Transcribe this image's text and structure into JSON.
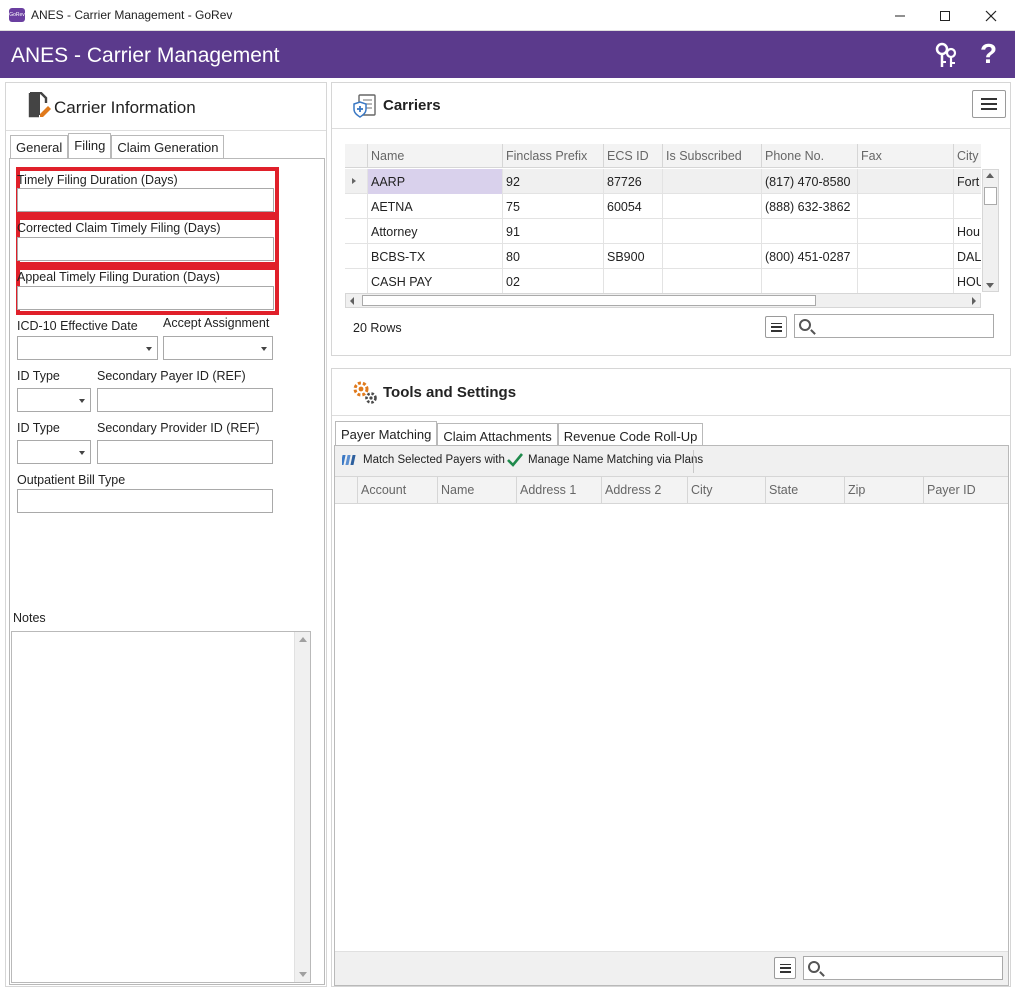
{
  "window": {
    "title": "ANES - Carrier Management - GoRev",
    "app_icon_text": "GoRev",
    "controls": [
      "minimize",
      "maximize",
      "close"
    ]
  },
  "header": {
    "title": "ANES - Carrier Management",
    "help_label": "?",
    "color": "#5b3a8c"
  },
  "carrier_info": {
    "title": "Carrier Information",
    "tabs": [
      "General",
      "Filing",
      "Claim Generation"
    ],
    "active_tab": "Filing",
    "fields": {
      "timely_filing": {
        "label": "Timely Filing Duration (Days)",
        "value": ""
      },
      "corrected_claim": {
        "label": "Corrected Claim Timely Filing (Days)",
        "value": ""
      },
      "appeal_filing": {
        "label": "Appeal Timely Filing Duration (Days)",
        "value": ""
      },
      "icd10_date": {
        "label": "ICD-10 Effective Date",
        "value": ""
      },
      "accept_assignment": {
        "label": "Accept Assignment",
        "value": ""
      },
      "id_type_1": {
        "label": "ID Type",
        "value": ""
      },
      "secondary_payer_id": {
        "label": "Secondary Payer ID (REF)",
        "value": ""
      },
      "id_type_2": {
        "label": "ID Type",
        "value": ""
      },
      "secondary_provider_id": {
        "label": "Secondary Provider ID (REF)",
        "value": ""
      },
      "outpatient_bill_type": {
        "label": "Outpatient Bill Type",
        "value": ""
      }
    },
    "notes_label": "Notes",
    "highlight_color": "#e0202a"
  },
  "carriers": {
    "title": "Carriers",
    "columns": [
      "Name",
      "Finclass Prefix",
      "ECS ID",
      "Is Subscribed",
      "Phone No.",
      "Fax",
      "City"
    ],
    "rows": [
      {
        "name": "AARP",
        "finclass": "92",
        "ecs": "87726",
        "subscribed": "",
        "phone": "(817) 470-8580",
        "fax": "",
        "city": "Fort"
      },
      {
        "name": "AETNA",
        "finclass": "75",
        "ecs": "60054",
        "subscribed": "",
        "phone": "(888) 632-3862",
        "fax": "",
        "city": ""
      },
      {
        "name": "Attorney",
        "finclass": "91",
        "ecs": "",
        "subscribed": "",
        "phone": "",
        "fax": "",
        "city": "Hou"
      },
      {
        "name": "BCBS-TX",
        "finclass": "80",
        "ecs": "SB900",
        "subscribed": "",
        "phone": "(800) 451-0287",
        "fax": "",
        "city": "DAL"
      },
      {
        "name": "CASH PAY",
        "finclass": "02",
        "ecs": "",
        "subscribed": "",
        "phone": "",
        "fax": "",
        "city": "HOU"
      }
    ],
    "selected_row": 0,
    "row_count": "20 Rows",
    "search_value": ""
  },
  "tools": {
    "title": "Tools and Settings",
    "tabs": [
      "Payer Matching",
      "Claim Attachments",
      "Revenue Code Roll-Up"
    ],
    "active_tab": "Payer Matching",
    "toolbar": {
      "match_label": "Match Selected Payers with",
      "manage_label": "Manage Name Matching via Plans"
    },
    "columns": [
      "Account",
      "Name",
      "Address 1",
      "Address 2",
      "City",
      "State",
      "Zip",
      "Payer ID"
    ],
    "search_value": ""
  }
}
